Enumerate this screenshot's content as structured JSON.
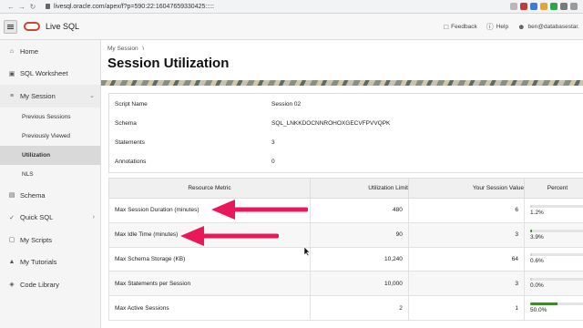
{
  "browser": {
    "url": "livesql.oracle.com/apex/f?p=590:22:16047659330425:::::"
  },
  "header": {
    "app_title": "Live SQL",
    "feedback": "Feedback",
    "help": "Help",
    "user": "ben@databasestar."
  },
  "sidebar": {
    "items": [
      {
        "label": "Home",
        "icon": "home-icon"
      },
      {
        "label": "SQL Worksheet",
        "icon": "worksheet-icon"
      },
      {
        "label": "My Session",
        "icon": "list-icon"
      },
      {
        "label": "Schema",
        "icon": "schema-icon"
      },
      {
        "label": "Quick SQL",
        "icon": "wrench-icon"
      },
      {
        "label": "My Scripts",
        "icon": "scripts-icon"
      },
      {
        "label": "My Tutorials",
        "icon": "tutorials-icon"
      },
      {
        "label": "Code Library",
        "icon": "library-icon"
      }
    ],
    "sub_items": [
      "Previous Sessions",
      "Previously Viewed",
      "Utilization",
      "NLS"
    ]
  },
  "main": {
    "breadcrumb": "My Session",
    "breadcrumb_sep": "\\",
    "title": "Session Utilization",
    "info": [
      {
        "key": "Script Name",
        "value": "Session 02"
      },
      {
        "key": "Schema",
        "value": "SQL_LNKKDOCNNROHOXGECVFPVVQPK"
      },
      {
        "key": "Statements",
        "value": "3"
      },
      {
        "key": "Annotations",
        "value": "0"
      }
    ],
    "table": {
      "headers": [
        "Resource Metric",
        "Utilization Limit",
        "Your Session Value",
        "Percent"
      ],
      "rows": [
        {
          "metric": "Max Session Duration (minutes)",
          "limit": "480",
          "value": "6",
          "pct": "1.2%",
          "fraction": 0.012,
          "color": "#cfcfcf"
        },
        {
          "metric": "Max Idle Time (minutes)",
          "limit": "90",
          "value": "3",
          "pct": "3.9%",
          "fraction": 0.039,
          "color": "#3d8c2a"
        },
        {
          "metric": "Max Schema Storage (KB)",
          "limit": "10,240",
          "value": "64",
          "pct": "0.6%",
          "fraction": 0.006,
          "color": "#cfcfcf"
        },
        {
          "metric": "Max Statements per Session",
          "limit": "10,000",
          "value": "3",
          "pct": "0.0%",
          "fraction": 0.0,
          "color": "#cfcfcf"
        },
        {
          "metric": "Max Active Sessions",
          "limit": "2",
          "value": "1",
          "pct": "50.0%",
          "fraction": 0.5,
          "color": "#3d8c2a"
        }
      ]
    }
  },
  "colors": {
    "annotation_arrow": "#e8185a",
    "oracle_red": "#c74634"
  }
}
